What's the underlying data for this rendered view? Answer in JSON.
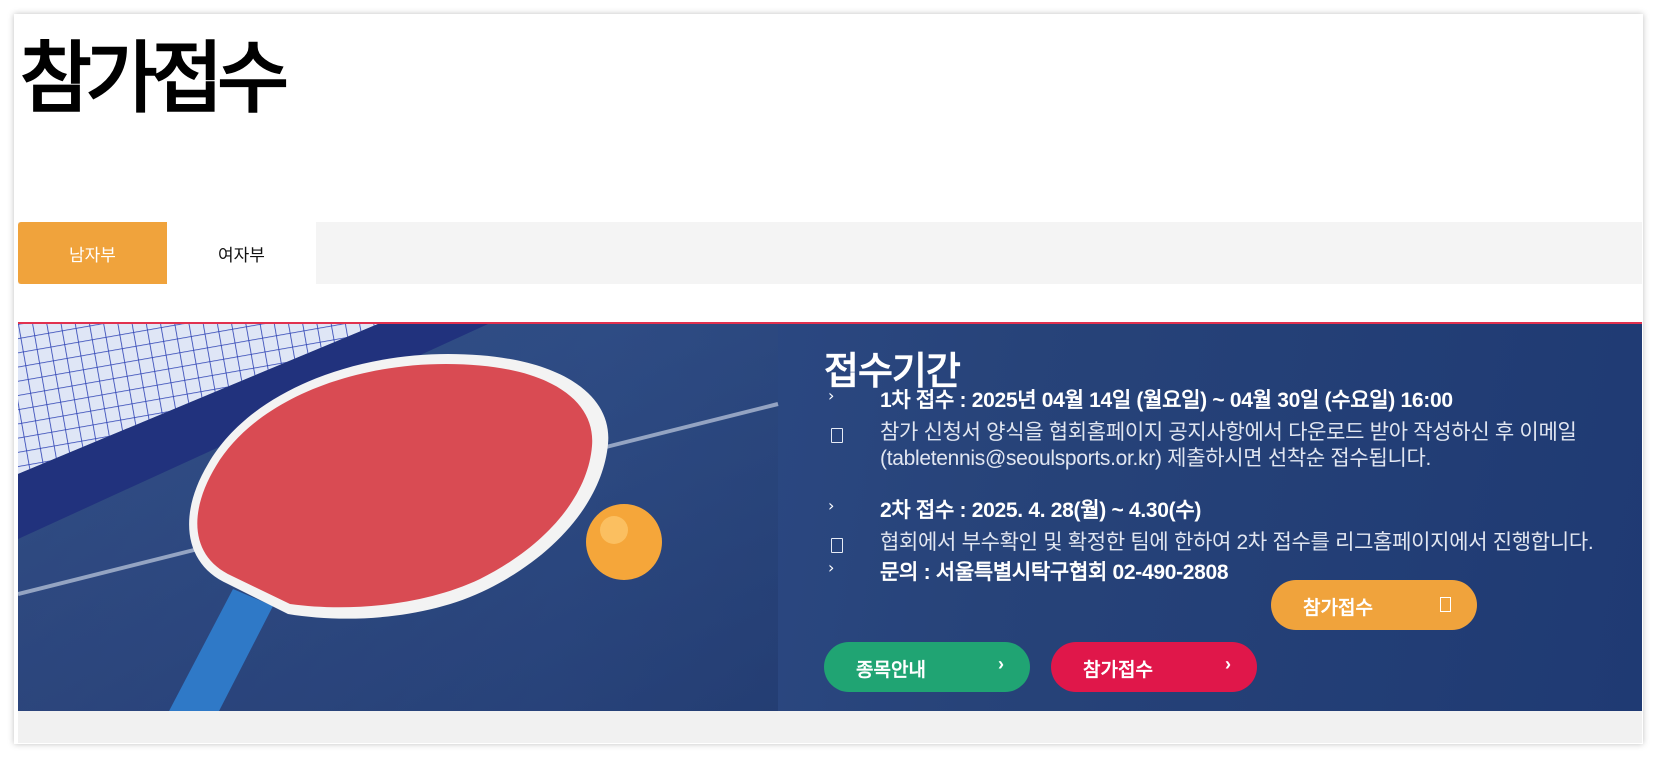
{
  "page": {
    "title": "참가접수"
  },
  "tabs": [
    {
      "label": "남자부",
      "active": true
    },
    {
      "label": "여자부",
      "active": false
    }
  ],
  "banner": {
    "title": "접수기간",
    "items": [
      {
        "bullet": "›",
        "text": "1차 접수 : 2025년 04월 14일 (월요일) ~ 04월 30일 (수요일) 16:00"
      },
      {
        "icon": "note-icon",
        "text": "참가 신청서 양식을 협회홈페이지 공지사항에서 다운로드 받아 작성하신 후 이메일 (tabletennis@seoulsports.or.kr) 제출하시면 선착순 접수됩니다.",
        "text_line1": "참가 신청서 양식을 협회홈페이지 공지사항에서 다운로드 받아 작성하신 후 이메일",
        "text_line2": "(tabletennis@seoulsports.or.kr) 제출하시면 선착순 접수됩니다."
      },
      {
        "bullet": "›",
        "text": "2차 접수 : 2025. 4. 28(월) ~ 4.30(수)"
      },
      {
        "icon": "note-icon",
        "text": "협회에서 부수확인 및 확정한 팀에 한하여 2차 접수를 리그홈페이지에서 진행합니다."
      },
      {
        "bullet": "›",
        "text": "문의 : 서울특별시탁구협회 02-490-2808"
      }
    ],
    "buttons": {
      "event_guide": "종목안내",
      "apply": "참가접수",
      "apply_float": "참가접수",
      "arrow": "›"
    }
  },
  "colors": {
    "accent_orange": "#f0a33c",
    "green": "#20a473",
    "red": "#e0174a",
    "banner_blue": "#2d4a86"
  }
}
